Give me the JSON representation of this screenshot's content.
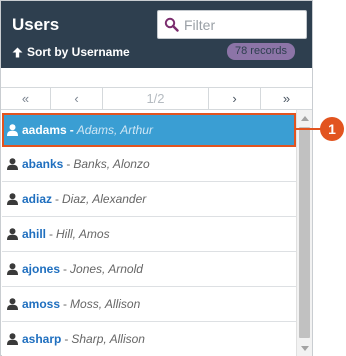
{
  "header": {
    "title": "Users",
    "filter_placeholder": "Filter",
    "sort_label": "Sort by Username",
    "record_count": "78 records"
  },
  "pager": {
    "first": "«",
    "prev": "‹",
    "page": "1/2",
    "next": "›",
    "last": "»"
  },
  "users": [
    {
      "username": "aadams",
      "separator": "-",
      "full_name": "Adams, Arthur",
      "selected": true
    },
    {
      "username": "abanks",
      "separator": "-",
      "full_name": "Banks, Alonzo"
    },
    {
      "username": "adiaz",
      "separator": "-",
      "full_name": "Diaz, Alexander"
    },
    {
      "username": "ahill",
      "separator": "-",
      "full_name": "Hill, Amos"
    },
    {
      "username": "ajones",
      "separator": "-",
      "full_name": "Jones, Arnold"
    },
    {
      "username": "amoss",
      "separator": "-",
      "full_name": "Moss, Allison"
    },
    {
      "username": "asharp",
      "separator": "-",
      "full_name": "Sharp, Allison"
    }
  ],
  "callout": {
    "number": "1"
  },
  "icons": {
    "search": "search-icon",
    "sort": "arrow-up-icon",
    "user": "user-icon"
  },
  "colors": {
    "header_bg": "#2e3f4f",
    "badge_bg": "#8c74a7",
    "selected_bg": "#3a9ed3",
    "highlight": "#e2541f",
    "username_link": "#1f6fbf"
  }
}
